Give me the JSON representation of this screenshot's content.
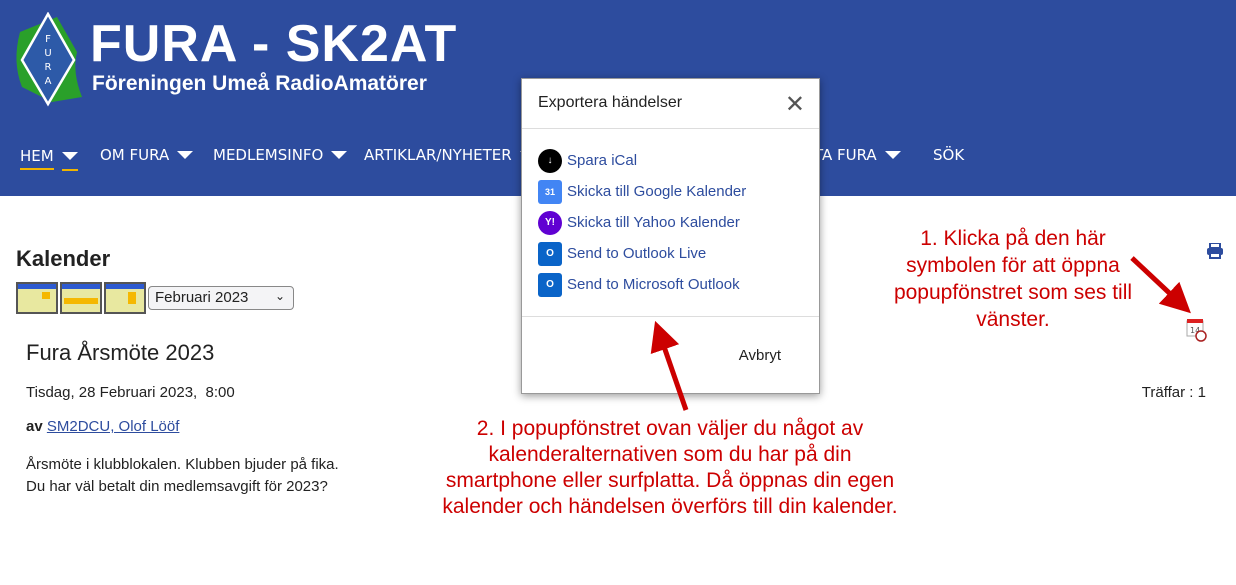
{
  "header": {
    "title": "FURA - SK2AT",
    "subtitle": "Föreningen Umeå RadioAmatörer",
    "logo_text": "FURA"
  },
  "nav": [
    {
      "label": "HEM",
      "active": true
    },
    {
      "label": "OM FURA"
    },
    {
      "label": "MEDLEMSINFO"
    },
    {
      "label": "ARTIKLAR/NYHETER"
    },
    {
      "label": "KONTAKTA FURA"
    },
    {
      "label": "SÖK"
    }
  ],
  "page": {
    "heading": "Kalender",
    "month_select": "Februari 2023",
    "view_icons": [
      "month-view-icon",
      "week-view-icon",
      "day-view-icon"
    ]
  },
  "event": {
    "title": "Fura Årsmöte 2023",
    "date": "Tisdag, 28 Februari 2023,  8:00",
    "by_label": "av",
    "author": "SM2DCU, Olof Lööf",
    "desc1": "Årsmöte i klubblokalen. Klubben bjuder på fika.",
    "desc2": "Du har väl betalt din medlemsavgift för 2023?",
    "hits": "Träffar : 1"
  },
  "modal": {
    "title": "Exportera händelser",
    "items": [
      "Spara iCal",
      "Skicka till Google Kalender",
      "Skicka till Yahoo Kalender",
      "Send to Outlook Live",
      "Send to Microsoft Outlook"
    ],
    "cancel": "Avbryt"
  },
  "annotations": {
    "a1": "1. Klicka på den här symbolen för att öppna popupfönstret som ses till vänster.",
    "a2": "2. I popupfönstret ovan väljer du något av kalenderalternativen som du har på din smartphone eller surfplatta. Då öppnas din egen kalender och händelsen överförs till din kalender."
  },
  "colors": {
    "header": "#2d4c9e",
    "accent": "#f0b400",
    "annotation": "#cc0000",
    "link": "#2d4c9e"
  }
}
